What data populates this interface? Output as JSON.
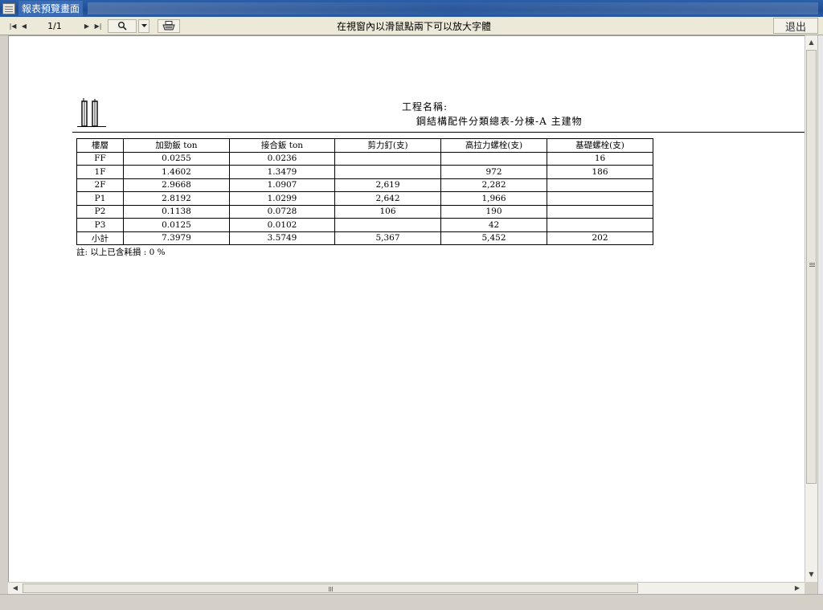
{
  "window": {
    "title": "報表預覽畫面"
  },
  "toolbar": {
    "first_icon": "first-page-icon",
    "prev_icon": "prev-page-icon",
    "page_indicator": "1/1",
    "next_icon": "next-page-icon",
    "last_icon": "last-page-icon",
    "zoom_icon": "magnifier-icon",
    "print_icon": "printer-icon",
    "hint": "在視窗內以滑鼠點兩下可以放大字體",
    "exit_label": "退出"
  },
  "report": {
    "project_label": "工程名稱:",
    "title": "鋼結構配件分類總表-分棟-A 主建物",
    "columns": [
      "樓層",
      "加勁鈑 ton",
      "接合鈑 ton",
      "剪力釘(支)",
      "高拉力螺栓(支)",
      "基礎螺栓(支)"
    ],
    "rows": [
      [
        "FF",
        "0.0255",
        "0.0236",
        "",
        "",
        "16"
      ],
      [
        "1F",
        "1.4602",
        "1.3479",
        "",
        "972",
        "186"
      ],
      [
        "2F",
        "2.9668",
        "1.0907",
        "2,619",
        "2,282",
        ""
      ],
      [
        "P1",
        "2.8192",
        "1.0299",
        "2,642",
        "1,966",
        ""
      ],
      [
        "P2",
        "0.1138",
        "0.0728",
        "106",
        "190",
        ""
      ],
      [
        "P3",
        "0.0125",
        "0.0102",
        "",
        "42",
        ""
      ],
      [
        "小計",
        "7.3979",
        "3.5749",
        "5,367",
        "5,452",
        "202"
      ]
    ],
    "note": "註: 以上已含耗損 : 0 %"
  },
  "colors": {
    "titlebar": "#1e4d94",
    "chrome": "#ece9d8",
    "page": "#ffffff"
  }
}
